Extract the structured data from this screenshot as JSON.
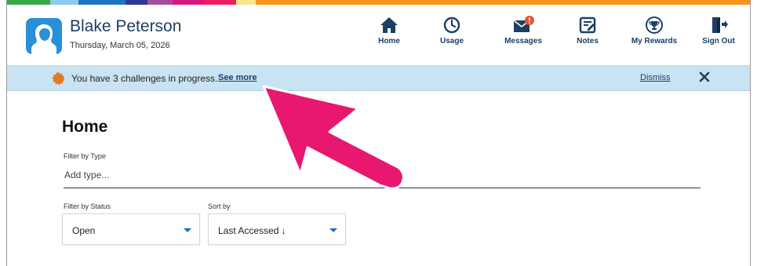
{
  "theme": {
    "brand_stripe": [
      "#3aa648",
      "#8ec8ea",
      "#1e73be",
      "#2b3990",
      "#a64d9c",
      "#d6197e",
      "#e91e63",
      "#f6e58d",
      "#f7941d"
    ],
    "nav_color": "#1d3f64",
    "banner_bg": "#c9e3f2",
    "badge_color": "#e8542f",
    "arrow_color": "#e8176f"
  },
  "user": {
    "name": "Blake Peterson",
    "date": "Thursday, March 05, 2026"
  },
  "nav": {
    "items": [
      {
        "label": "Home",
        "icon": "home-icon"
      },
      {
        "label": "Usage",
        "icon": "clock-icon"
      },
      {
        "label": "Messages",
        "icon": "envelope-icon",
        "badge": "!"
      },
      {
        "label": "Notes",
        "icon": "notes-icon"
      },
      {
        "label": "My Rewards",
        "icon": "trophy-icon"
      },
      {
        "label": "Sign Out",
        "icon": "sign-out-icon"
      }
    ]
  },
  "banner": {
    "text": "You have 3 challenges in progress.",
    "link": "See more",
    "dismiss": "Dismiss"
  },
  "main": {
    "title": "Home",
    "filter_type": {
      "label": "Filter by Type",
      "placeholder": "Add type..."
    },
    "filter_status": {
      "label": "Filter by Status",
      "value": "Open"
    },
    "sort": {
      "label": "Sort by",
      "value": "Last Accessed ↓"
    }
  }
}
